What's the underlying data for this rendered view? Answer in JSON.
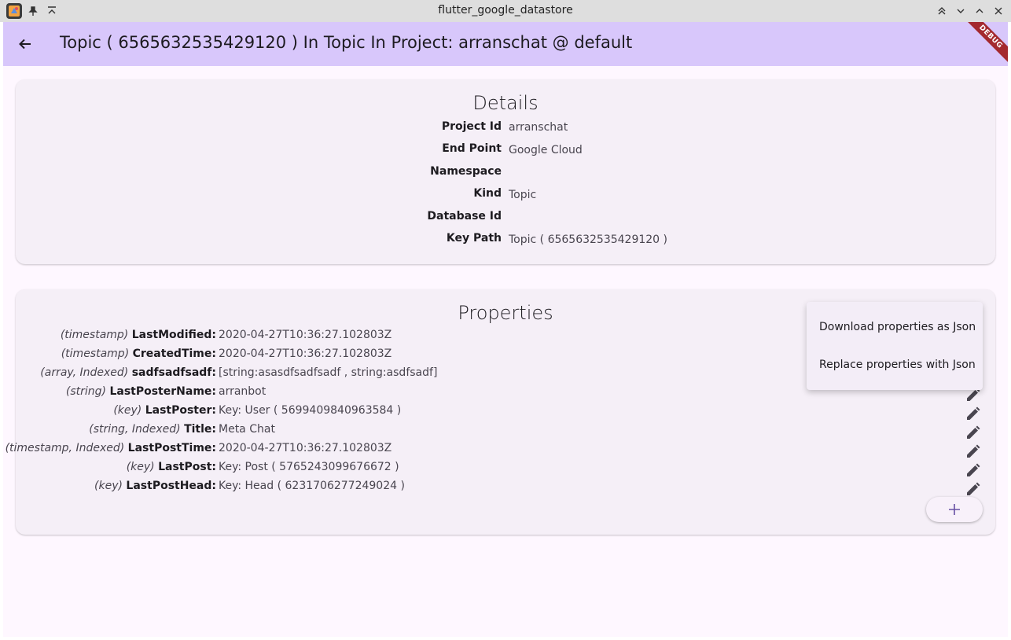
{
  "window": {
    "title": "flutter_google_datastore"
  },
  "appbar": {
    "title": "Topic ( 6565632535429120 ) In Topic In Project: arranschat @ default",
    "debug_banner": "DEBUG"
  },
  "details": {
    "title": "Details",
    "rows": [
      {
        "label": "Project Id",
        "value": "arranschat"
      },
      {
        "label": "End Point",
        "value": "Google Cloud"
      },
      {
        "label": "Namespace",
        "value": ""
      },
      {
        "label": "Kind",
        "value": "Topic"
      },
      {
        "label": "Database Id",
        "value": ""
      },
      {
        "label": "Key Path",
        "value": "Topic ( 6565632535429120 )"
      }
    ]
  },
  "properties": {
    "title": "Properties",
    "rows": [
      {
        "type": "(timestamp)",
        "name": "LastModified:",
        "value": "2020-04-27T10:36:27.102803Z"
      },
      {
        "type": "(timestamp)",
        "name": "CreatedTime:",
        "value": "2020-04-27T10:36:27.102803Z"
      },
      {
        "type": "(array, Indexed)",
        "name": "sadfsadfsadf:",
        "value": "[string:asasdfsadfsadf , string:asdfsadf]"
      },
      {
        "type": "(string)",
        "name": "LastPosterName:",
        "value": "arranbot"
      },
      {
        "type": "(key)",
        "name": "LastPoster:",
        "value": "Key: User ( 5699409840963584 )"
      },
      {
        "type": "(string, Indexed)",
        "name": "Title:",
        "value": "Meta Chat"
      },
      {
        "type": "(timestamp, Indexed)",
        "name": "LastPostTime:",
        "value": "2020-04-27T10:36:27.102803Z"
      },
      {
        "type": "(key)",
        "name": "LastPost:",
        "value": "Key: Post ( 5765243099676672 )"
      },
      {
        "type": "(key)",
        "name": "LastPostHead:",
        "value": "Key: Head ( 6231706277249024 )"
      }
    ],
    "add_icon": "plus-icon"
  },
  "menu": {
    "items": [
      {
        "label": "Download properties as Json"
      },
      {
        "label": "Replace properties with Json"
      }
    ]
  },
  "colors": {
    "appbar": "#d8c7fb",
    "background": "#fef7ff",
    "card": "#f5eff7",
    "debug_banner": "#a4292f"
  }
}
